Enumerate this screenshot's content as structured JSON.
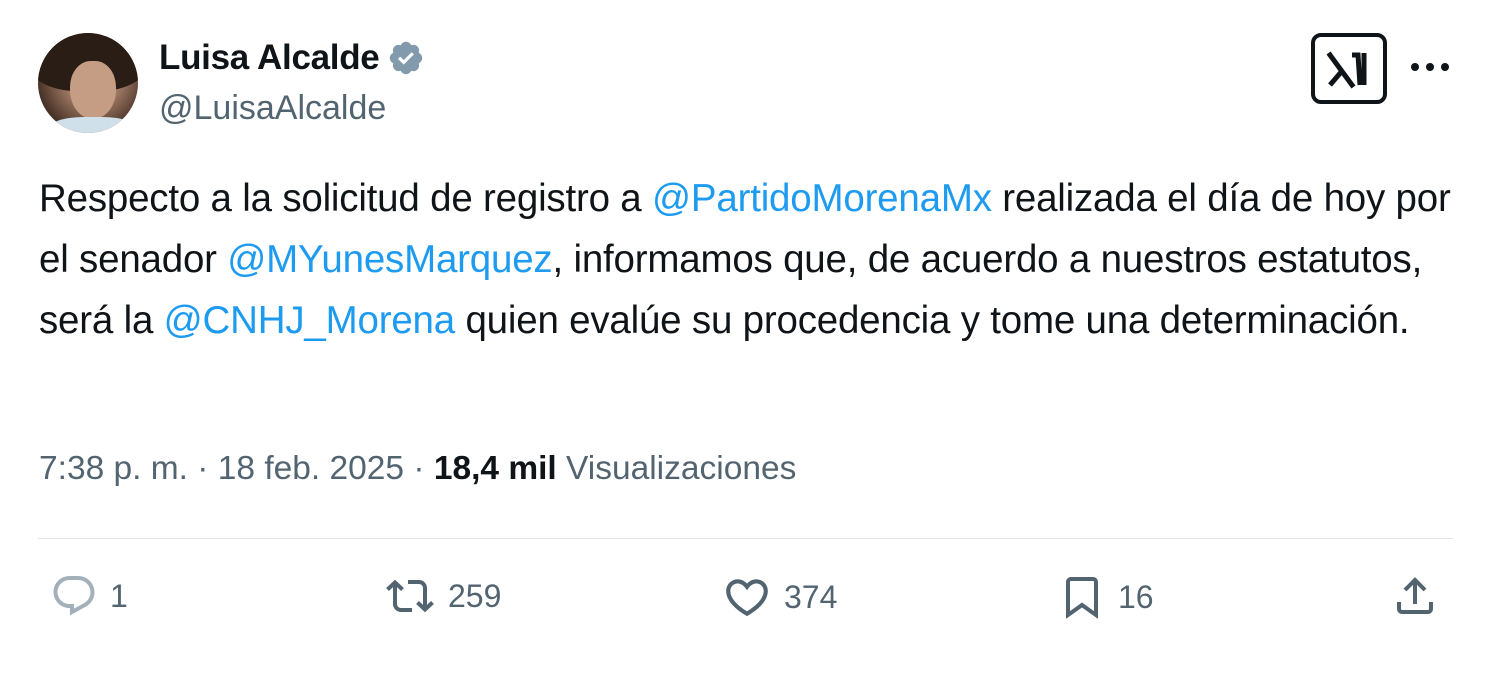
{
  "author": {
    "display_name": "Luisa Alcalde",
    "handle": "@LuisaAlcalde",
    "verified": true
  },
  "header_icons": [
    "grok-icon",
    "more-icon"
  ],
  "tweet": {
    "segments": [
      {
        "text": "Respecto a la solicitud de registro a ",
        "mention": false
      },
      {
        "text": "@PartidoMorenaMx",
        "mention": true
      },
      {
        "text": " realizada el día de hoy por el senador ",
        "mention": false
      },
      {
        "text": "@MYunesMarquez",
        "mention": true
      },
      {
        "text": ", informamos que, de acuerdo a nuestros estatutos, será la ",
        "mention": false
      },
      {
        "text": "@CNHJ_Morena",
        "mention": true
      },
      {
        "text": " quien evalúe su procedencia y tome una determinación.",
        "mention": false
      }
    ]
  },
  "meta": {
    "time": "7:38 p. m.",
    "separator": "·",
    "date": "18 feb. 2025",
    "views_count": "18,4 mil",
    "views_label": "Visualizaciones"
  },
  "actions": {
    "replies": "1",
    "reposts": "259",
    "likes": "374",
    "bookmarks": "16"
  },
  "colors": {
    "text": "#0f1419",
    "secondary": "#536471",
    "mention": "#1d9bf0",
    "verified_badge": "#829aab"
  }
}
